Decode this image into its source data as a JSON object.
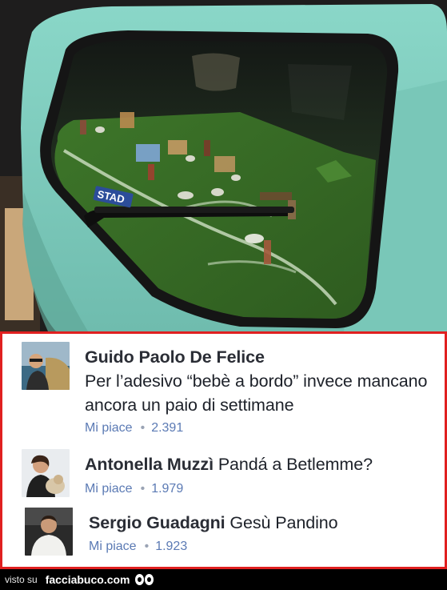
{
  "photo": {
    "sticker_text": "STAD"
  },
  "comments": [
    {
      "author": "Guido Paolo De Felice",
      "text": "Per l’adesivo “bebè a bordo” invece mancano ancora un paio di settimane",
      "like_label": "Mi piace",
      "likes": "2.391"
    },
    {
      "author": "Antonella Muzzì",
      "text": "Pandá a Betlemme?",
      "like_label": "Mi piace",
      "likes": "1.979"
    },
    {
      "author": "Sergio Guadagni",
      "text": "Gesù Pandino",
      "like_label": "Mi piace",
      "likes": "1.923"
    }
  ],
  "footer": {
    "seen_on": "visto su",
    "brand": "facciabuco.com"
  },
  "colors": {
    "frame_border": "#e02020",
    "like_link": "#5b7ab4",
    "car_body": "#7fcfc0"
  }
}
